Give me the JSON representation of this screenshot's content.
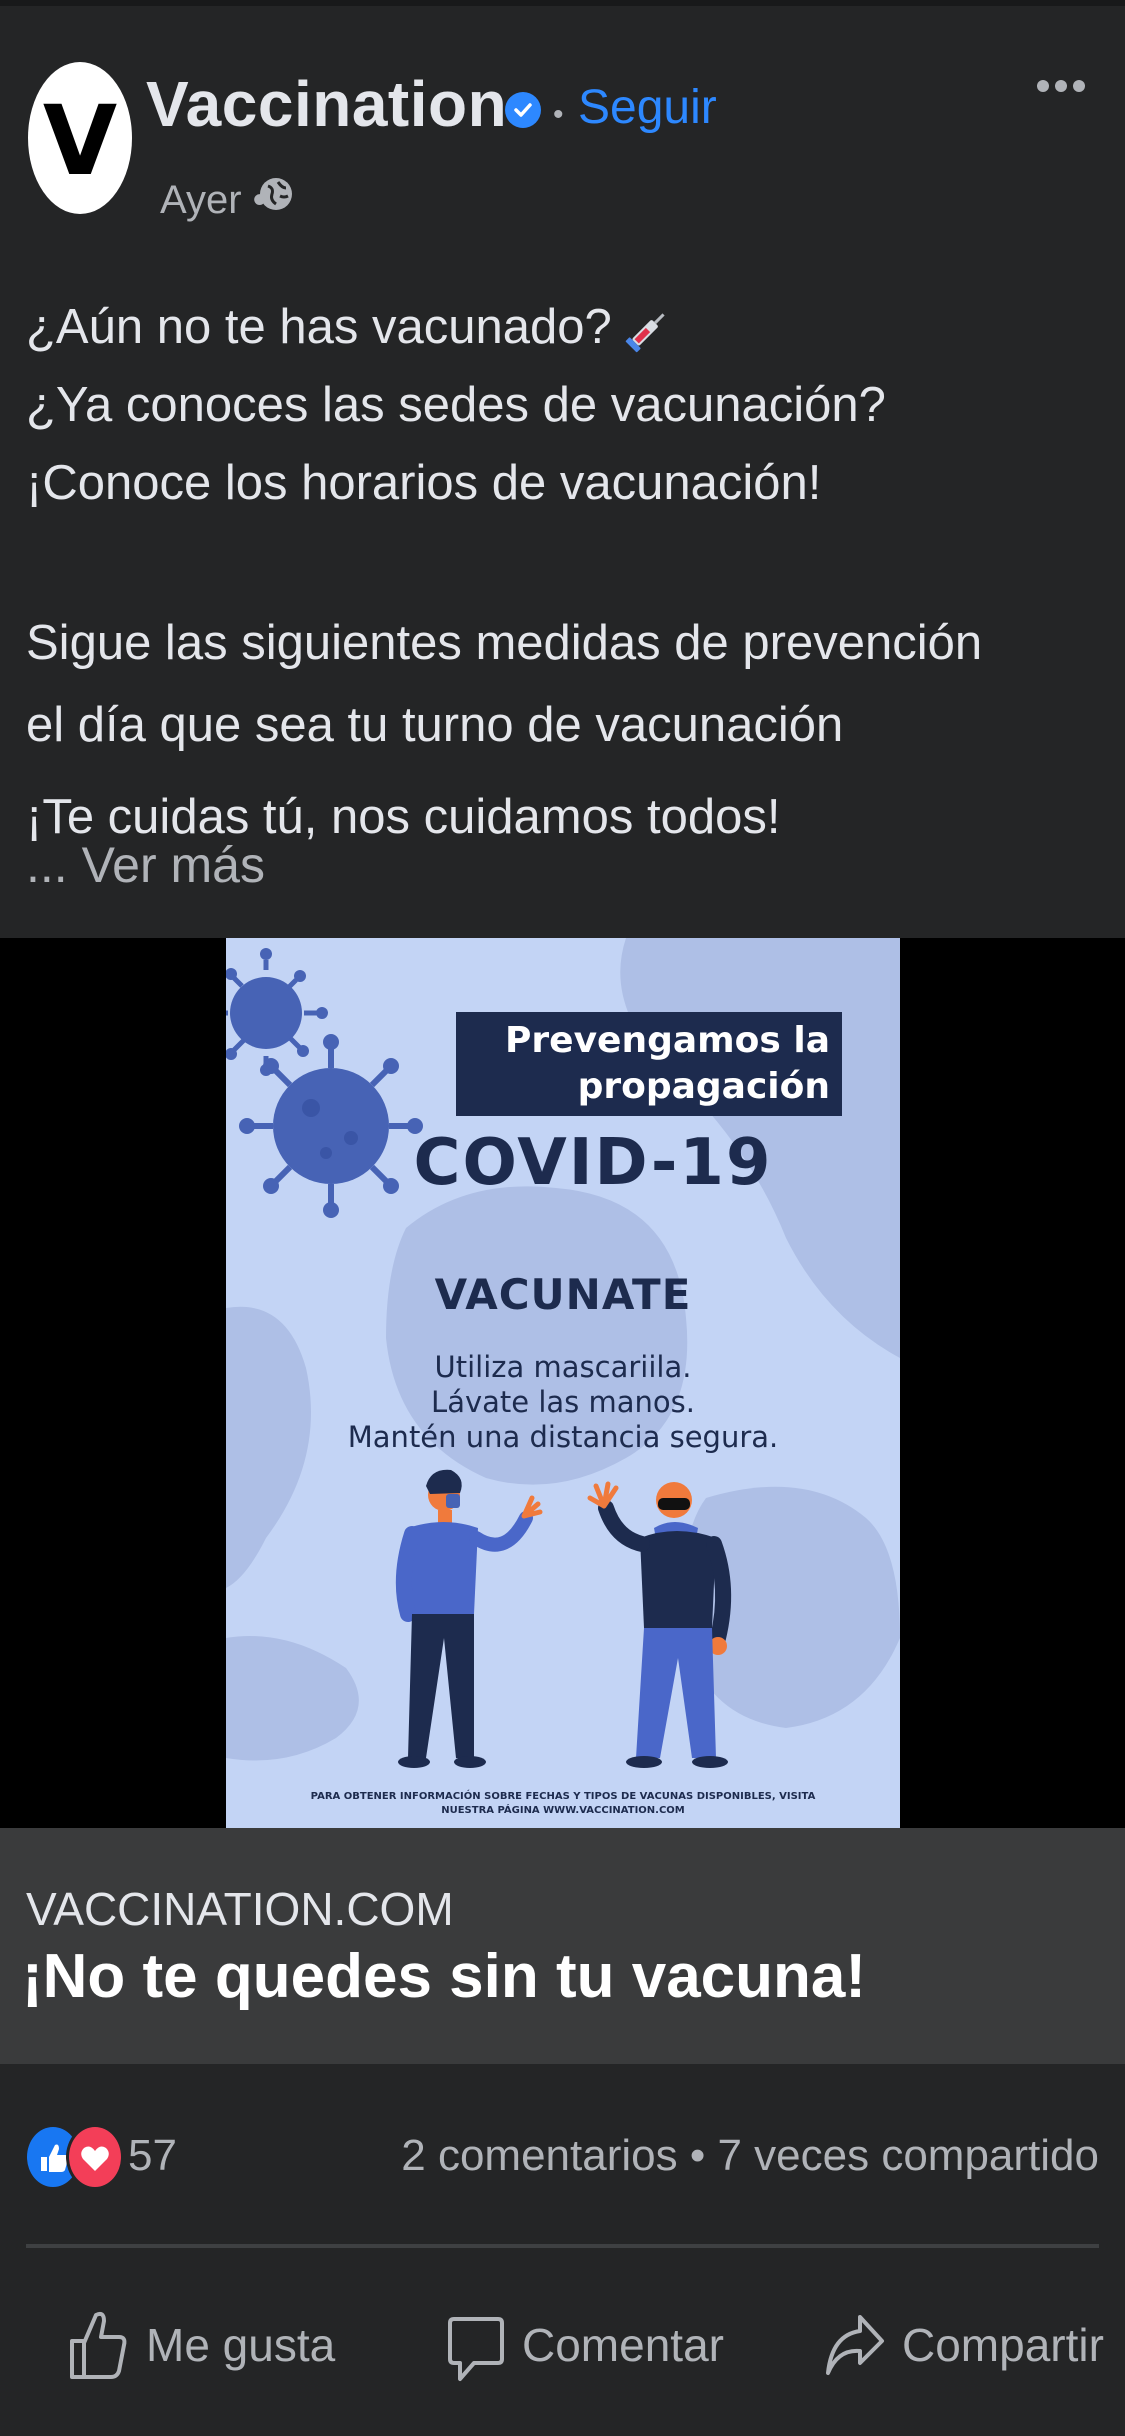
{
  "post": {
    "avatar_letter": "V",
    "page_name": "Vaccination",
    "follow_label": "Seguir",
    "separator": "•",
    "time": "Ayer •",
    "text_lines": [
      "¿Aún no te has vacunado?",
      "¿Ya conoces las sedes de vacunación?",
      "¡Conoce los horarios de vacunación!",
      "Sigue las siguientes medidas de prevención",
      "el día que sea tu turno de vacunación",
      "¡Te cuidas tú, nos cuidamos todos!"
    ],
    "see_more": "... Ver más"
  },
  "poster": {
    "title_line1": "Prevengamos la",
    "title_line2": "propagación",
    "headline": "COVID-19",
    "subheadline": "VACUNATE",
    "tips": [
      "Utiliza mascariila.",
      "Lávate las manos.",
      "Mantén una distancia segura."
    ],
    "footer_line1": "PARA OBTENER INFORMACIÓN SOBRE FECHAS Y TIPOS DE VACUNAS DISPONIBLES, VISITA",
    "footer_line2": "NUESTRA PÁGINA WWW.VACCINATION.COM"
  },
  "link_preview": {
    "domain": "VACCINATION.COM",
    "title": "¡No te quedes sin tu vacuna!"
  },
  "engagement": {
    "reaction_count": "57",
    "stats": "2 comentarios • 7 veces compartido"
  },
  "actions": {
    "like": "Me gusta",
    "comment": "Comentar",
    "share": "Compartir"
  },
  "icons": {
    "verified": "verified-badge-icon",
    "globe": "globe-icon",
    "more": "more-options-icon",
    "syringe": "syringe-emoji"
  },
  "colors": {
    "background": "#242526",
    "accent": "#2d88ff",
    "poster_bg": "#c3d4f5",
    "poster_navy": "#1d2b4e"
  }
}
